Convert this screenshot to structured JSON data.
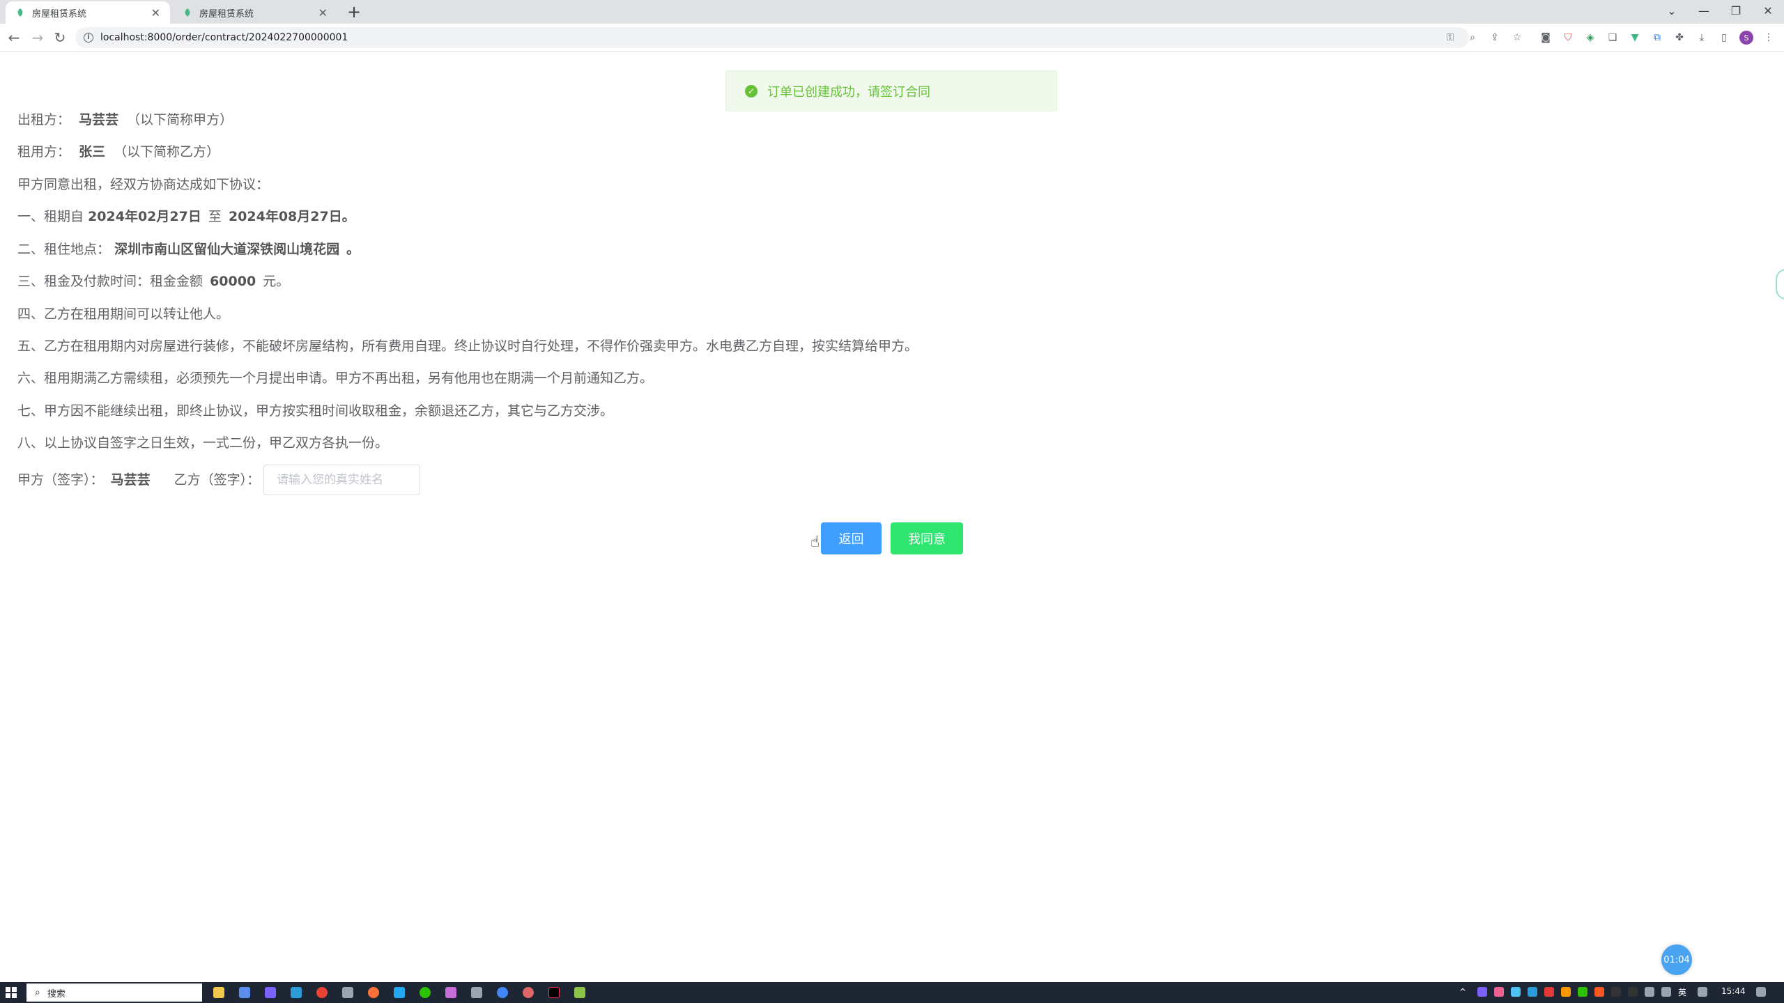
{
  "browser": {
    "tabs": [
      {
        "title": "房屋租赁系统",
        "active": true
      },
      {
        "title": "房屋租赁系统",
        "active": false
      }
    ],
    "url": "localhost:8000/order/contract/2024022700000001",
    "profile_initial": "S"
  },
  "toast": {
    "message": "订单已创建成功，请签订合同",
    "color": "#67c23a"
  },
  "contract": {
    "lessor_label": "出租方：",
    "lessor_name": "马芸芸",
    "lessor_suffix": "（以下简称甲方）",
    "lessee_label": "租用方：",
    "lessee_name": "张三",
    "lessee_suffix": "（以下简称乙方）",
    "intro": "甲方同意出租，经双方协商达成如下协议：",
    "clause1_prefix": "一、租期自",
    "start_date": "2024年02月27日",
    "clause1_to": "至",
    "end_date": "2024年08月27日。",
    "clause2_prefix": "二、租住地点：",
    "address": "深圳市南山区留仙大道深铁阅山境花园",
    "clause2_suffix": "。",
    "clause3_prefix": "三、租金及付款时间：租金金额",
    "amount": "60000",
    "clause3_suffix": "元。",
    "clause4": "四、乙方在租用期间可以转让他人。",
    "clause5": "五、乙方在租用期内对房屋进行装修，不能破坏房屋结构，所有费用自理。终止协议时自行处理，不得作价强卖甲方。水电费乙方自理，按实结算给甲方。",
    "clause6": "六、租用期满乙方需续租，必须预先一个月提出申请。甲方不再出租，另有他用也在期满一个月前通知乙方。",
    "clause7": "七、甲方因不能继续出租，即终止协议，甲方按实租时间收取租金，余额退还乙方，其它与乙方交涉。",
    "clause8": "八、以上协议自签字之日生效，一式二份，甲乙双方各执一份。",
    "party_a_sign_label": "甲方（签字）：",
    "party_a_sign_name": "马芸芸",
    "party_b_sign_label": "乙方（签字）：",
    "party_b_sign_placeholder": "请输入您的真实姓名",
    "party_b_sign_value": ""
  },
  "actions": {
    "back_label": "返回",
    "back_color": "#409eff",
    "agree_label": "我同意",
    "agree_color": "#2ee66f"
  },
  "timer": {
    "text": "01:04"
  },
  "taskbar": {
    "search_placeholder": "搜索",
    "ime": "英",
    "time": "15:44"
  }
}
